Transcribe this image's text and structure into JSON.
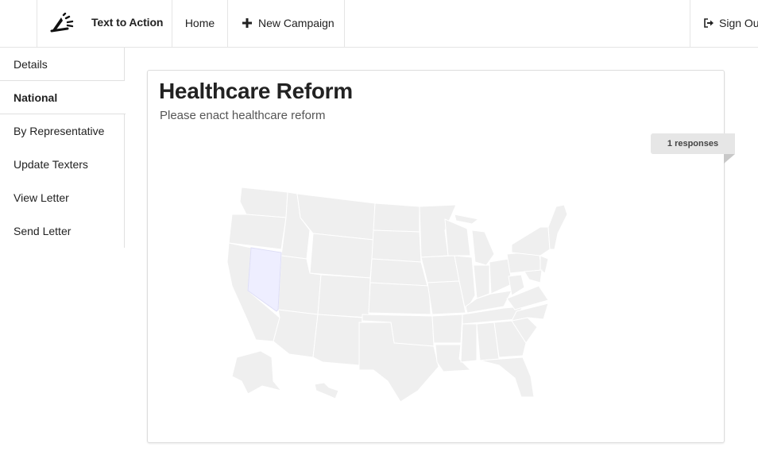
{
  "brand": {
    "name": "Text to Action",
    "icon": "megaphone-icon"
  },
  "nav": {
    "home_label": "Home",
    "new_campaign_label": "New Campaign",
    "new_campaign_icon": "plus-icon",
    "sign_out_label": "Sign Out",
    "sign_out_icon": "sign-out-icon"
  },
  "sidebar": {
    "items": [
      {
        "label": "Details",
        "active": false
      },
      {
        "label": "National",
        "active": true
      },
      {
        "label": "By Representative",
        "active": false
      },
      {
        "label": "Update Texters",
        "active": false
      },
      {
        "label": "View Letter",
        "active": false
      },
      {
        "label": "Send Letter",
        "active": false
      }
    ]
  },
  "campaign": {
    "title": "Healthcare Reform",
    "subtitle": "Please enact healthcare reform",
    "responses_label": "1 responses"
  },
  "map": {
    "highlighted_states": [
      "Nevada"
    ],
    "base_color": "#efefef",
    "highlight_color": "#eeeeff",
    "border_color": "#ffffff"
  }
}
